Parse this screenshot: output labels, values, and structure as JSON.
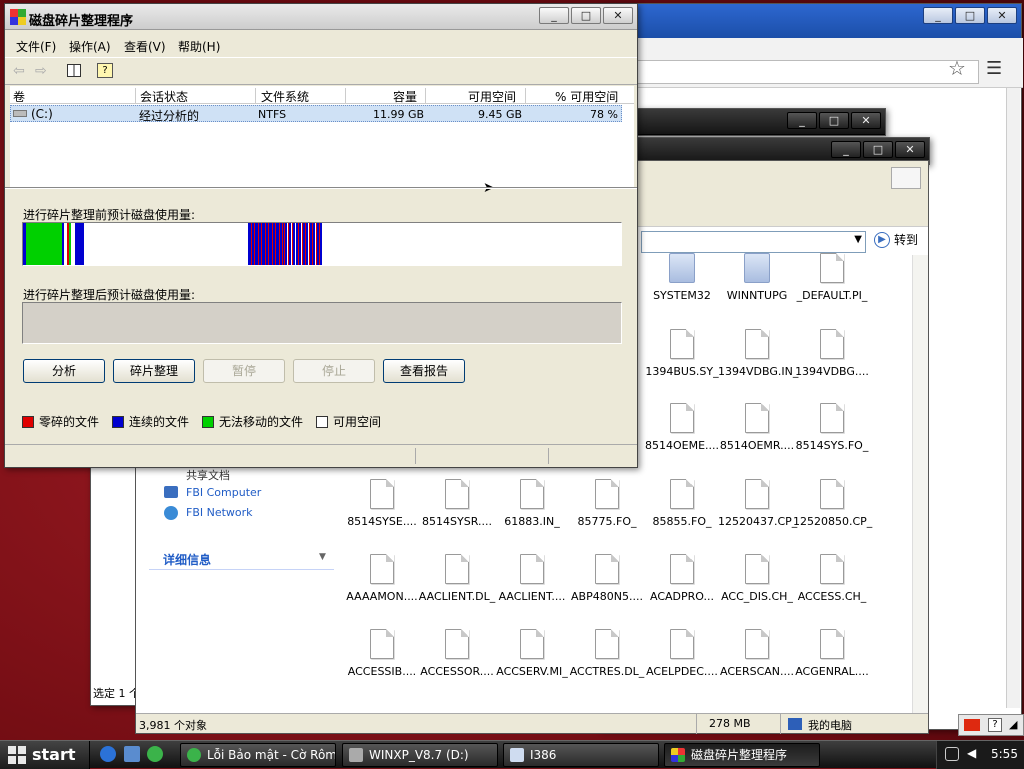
{
  "defrag": {
    "title": "磁盘碎片整理程序",
    "menu": [
      "文件(F)",
      "操作(A)",
      "查看(V)",
      "帮助(H)"
    ],
    "columns": [
      "卷",
      "会话状态",
      "文件系统",
      "容量",
      "可用空间",
      "% 可用空间"
    ],
    "volume": {
      "name": "(C:)",
      "status": "经过分析的",
      "fs": "NTFS",
      "capacity": "11.99 GB",
      "free": "9.45 GB",
      "free_pct": "78 %"
    },
    "before_label": "进行碎片整理前预计磁盘使用量:",
    "after_label": "进行碎片整理后预计磁盘使用量:",
    "buttons": {
      "analyze": "分析",
      "defrag": "碎片整理",
      "pause": "暂停",
      "stop": "停止",
      "report": "查看报告"
    },
    "legend": {
      "fragmented": "零碎的文件",
      "contiguous": "连续的文件",
      "unmovable": "无法移动的文件",
      "free": "可用空间"
    },
    "colors": {
      "fragmented": "#e00000",
      "contiguous": "#0000d0",
      "unmovable": "#00d000",
      "free": "#ffffff"
    }
  },
  "explorer": {
    "go_label": "转到",
    "sidebar": {
      "items": [
        "共享文档",
        "FBI Computer",
        "FBI Network"
      ],
      "details": "详细信息",
      "partial": "详"
    },
    "files": [
      [
        "SYSTEM32",
        "WINNTUPG",
        "_DEFAULT.PI_"
      ],
      [
        "1394BUS.SY_",
        "1394VDBG.IN_",
        "1394VDBG...."
      ],
      [
        "8514OEME....",
        "8514OEMR....",
        "8514SYS.FO_"
      ],
      [
        "8514SYSE....",
        "8514SYSR....",
        "61883.IN_",
        "85775.FO_",
        "85855.FO_",
        "12520437.CP_",
        "12520850.CP_"
      ],
      [
        "AAAAMON....",
        "AACLIENT.DL_",
        "AACLIENT....",
        "ABP480N5....",
        "ACADPRO...",
        "ACC_DIS.CH_",
        "ACCESS.CH_"
      ],
      [
        "ACCESSIB....",
        "ACCESSOR....",
        "ACCSERV.MI_",
        "ACCTRES.DL_",
        "ACELPDEC....",
        "ACERSCAN....",
        "ACGENRAL...."
      ]
    ],
    "status": {
      "count": "3,981 个对象",
      "size": "278 MB",
      "location": "我的电脑"
    },
    "back_window_status": "选定 1 个"
  },
  "taskbar": {
    "start": "start",
    "items": [
      "Lỗi Bảo mật - Cờ Rôm+",
      "WINXP_V8.7 (D:)",
      "I386",
      "磁盘碎片整理程序"
    ],
    "clock": "5:55"
  }
}
